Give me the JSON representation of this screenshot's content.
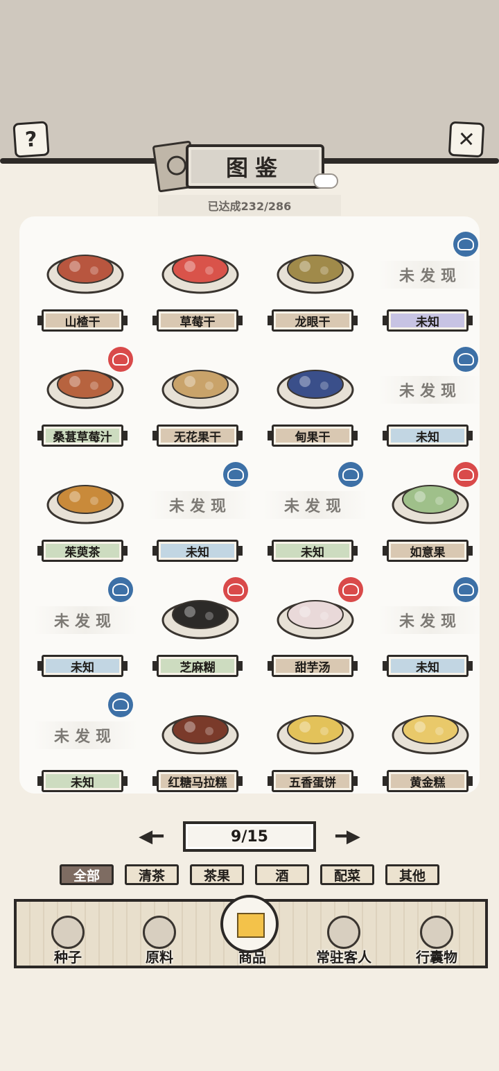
{
  "header": {
    "help_icon": "question-icon",
    "close_icon": "close-icon",
    "title": "图鉴",
    "progress": "已达成232/286"
  },
  "items": [
    {
      "label": "山楂干",
      "status": "discovered",
      "theme": "brown"
    },
    {
      "label": "草莓干",
      "status": "discovered",
      "theme": "brown"
    },
    {
      "label": "龙眼干",
      "status": "discovered",
      "theme": "brown"
    },
    {
      "label": "未知",
      "status": "undiscovered",
      "theme": "purple",
      "placeholder": "未发现",
      "stamp": "blue"
    },
    {
      "label": "桑葚草莓汁",
      "status": "discovered",
      "theme": "green",
      "stamp": "red"
    },
    {
      "label": "无花果干",
      "status": "discovered",
      "theme": "brown"
    },
    {
      "label": "甸果干",
      "status": "discovered",
      "theme": "brown"
    },
    {
      "label": "未知",
      "status": "undiscovered",
      "theme": "blue",
      "placeholder": "未发现",
      "stamp": "blue"
    },
    {
      "label": "茱萸茶",
      "status": "discovered",
      "theme": "green"
    },
    {
      "label": "未知",
      "status": "undiscovered",
      "theme": "blue",
      "placeholder": "未发现",
      "stamp": "blue"
    },
    {
      "label": "未知",
      "status": "undiscovered",
      "theme": "green",
      "placeholder": "未发现",
      "stamp": "blue"
    },
    {
      "label": "如意果",
      "status": "discovered",
      "theme": "brown",
      "stamp": "red"
    },
    {
      "label": "未知",
      "status": "undiscovered",
      "theme": "blue",
      "placeholder": "未发现",
      "stamp": "blue"
    },
    {
      "label": "芝麻糊",
      "status": "discovered",
      "theme": "green",
      "stamp": "red"
    },
    {
      "label": "甜芋汤",
      "status": "discovered",
      "theme": "brown",
      "stamp": "red"
    },
    {
      "label": "未知",
      "status": "undiscovered",
      "theme": "blue",
      "placeholder": "未发现",
      "stamp": "blue"
    },
    {
      "label": "未知",
      "status": "undiscovered",
      "theme": "green",
      "placeholder": "未发现",
      "stamp": "blue"
    },
    {
      "label": "红糖马拉糕",
      "status": "discovered",
      "theme": "brown"
    },
    {
      "label": "五香蛋饼",
      "status": "discovered",
      "theme": "brown"
    },
    {
      "label": "黄金糕",
      "status": "discovered",
      "theme": "brown"
    }
  ],
  "pager": {
    "text": "9/15",
    "prev_icon": "arrow-left-icon",
    "next_icon": "arrow-right-icon"
  },
  "filters": [
    {
      "label": "全部",
      "active": true
    },
    {
      "label": "清茶",
      "active": false
    },
    {
      "label": "茶果",
      "active": false
    },
    {
      "label": "酒",
      "active": false
    },
    {
      "label": "配菜",
      "active": false
    },
    {
      "label": "其他",
      "active": false
    }
  ],
  "nav": [
    {
      "label": "种子",
      "icon": "seed-jar-icon"
    },
    {
      "label": "原料",
      "icon": "leaf-icon"
    },
    {
      "label": "商品",
      "icon": "cake-box-icon",
      "active": true
    },
    {
      "label": "常驻客人",
      "icon": "guest-girl-icon"
    },
    {
      "label": "行囊物",
      "icon": "backpack-icon"
    }
  ],
  "colors": {
    "accent_active_filter": "#7e6c62",
    "stamp_blue": "#3d70a6",
    "stamp_red": "#d94a4a"
  }
}
